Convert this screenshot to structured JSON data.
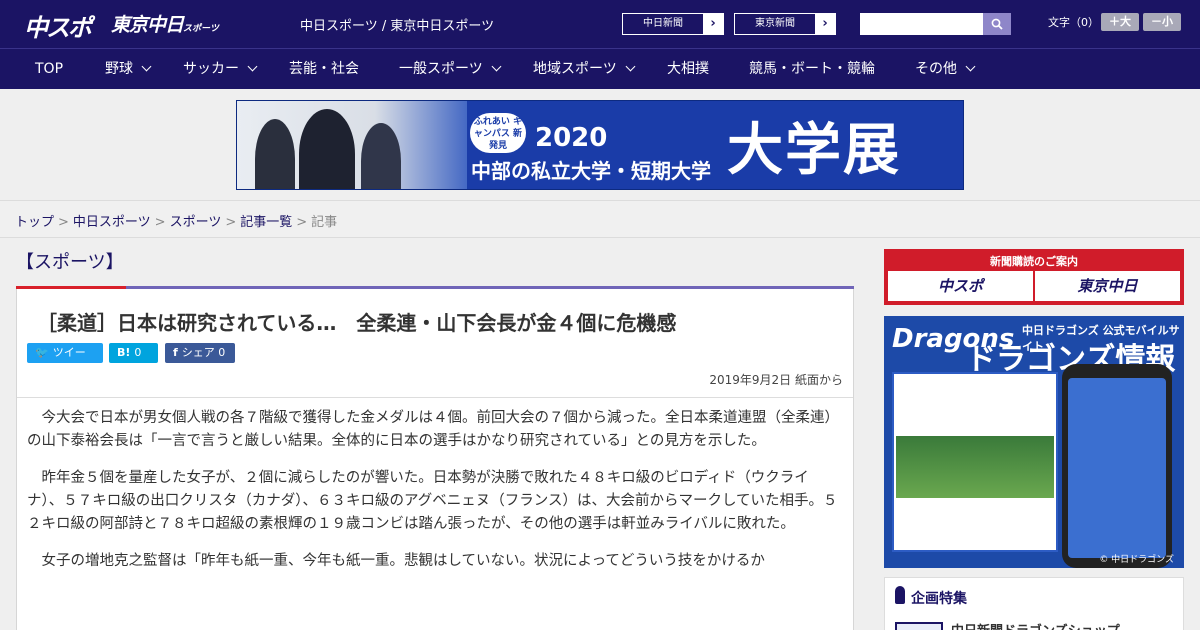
{
  "header": {
    "logo_chuspo": "中スポ",
    "logo_tokyo": "東京中日",
    "logo_tokyo_small": "スポーツ",
    "site_links": "中日スポーツ / 東京中日スポーツ",
    "news_buttons": [
      "中日新聞",
      "東京新聞"
    ],
    "fontsize_label": "文字（0）",
    "font_larger": "＋大",
    "font_smaller": "－小",
    "search_placeholder": ""
  },
  "nav": [
    "TOP",
    "野球",
    "サッカー",
    "芸能・社会",
    "一般スポーツ",
    "地域スポーツ",
    "大相撲",
    "競馬・ボート・競輪",
    "その他"
  ],
  "banner": {
    "badge": "ふれあい キャンパス 新発見",
    "year": "2020",
    "subtitle": "中部の私立大学・短期大学",
    "title": "大学展"
  },
  "breadcrumb": [
    "トップ",
    "中日スポーツ",
    "スポーツ",
    "記事一覧",
    "記事"
  ],
  "section": "【スポーツ】",
  "article": {
    "headline": "［柔道］日本は研究されている…　全柔連・山下会長が金４個に危機感",
    "share": {
      "tweet": "ツイート",
      "hatena_count": "0",
      "facebook": "シェア",
      "facebook_count": "0"
    },
    "dateline": "2019年9月2日 紙面から",
    "paragraphs": [
      "今大会で日本が男女個人戦の各７階級で獲得した金メダルは４個。前回大会の７個から減った。全日本柔道連盟（全柔連）の山下泰裕会長は「一言で言うと厳しい結果。全体的に日本の選手はかなり研究されている」との見方を示した。",
      "昨年金５個を量産した女子が、２個に減らしたのが響いた。日本勢が決勝で敗れた４８キロ級のビロディド（ウクライナ）、５７キロ級の出口クリスタ（カナダ）、６３キロ級のアグベニェヌ（フランス）は、大会前からマークしていた相手。５２キロ級の阿部詩と７８キロ超級の素根輝の１９歳コンビは踏ん張ったが、その他の選手は軒並みライバルに敗れた。",
      "女子の増地克之監督は「昨年も紙一重、今年も紙一重。悲観はしていない。状況によってどういう技をかけるか"
    ]
  },
  "sidebar": {
    "subscribe_head": "新聞購読のご案内",
    "subscribe_left": "中スポ",
    "subscribe_right": "東京中日",
    "dragons_logo": "Dragons",
    "dragons_sub": "中日ドラゴンズ 公式モバイルサイト",
    "dragons_title": "ドラゴンズ情報",
    "dragons_copy": "© 中日ドラゴンズ",
    "feature_title": "企画特集",
    "feature_item": "中日新聞ドラゴンズショップ"
  },
  "colors": {
    "brand": "#1b1464",
    "accent_red": "#d8202a",
    "twitter": "#1da1f2",
    "hatena": "#00a4de",
    "facebook": "#3b5998"
  }
}
